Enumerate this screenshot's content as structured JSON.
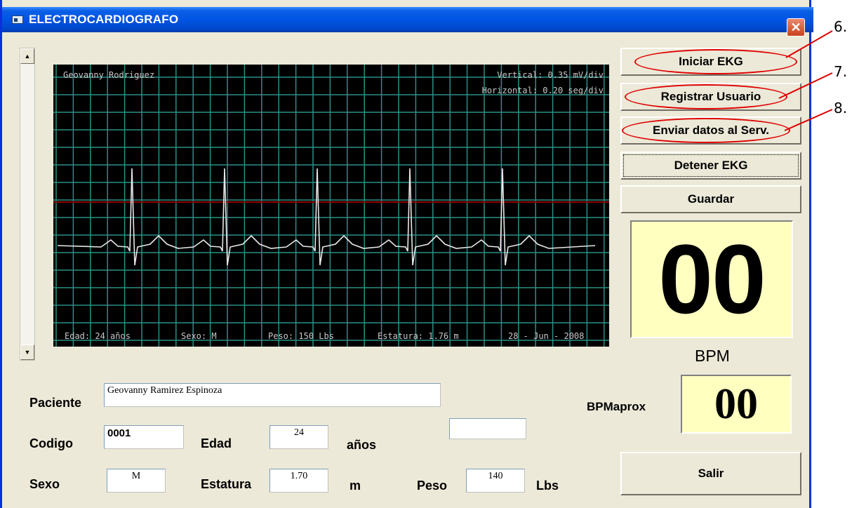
{
  "window": {
    "title": "ELECTROCARDIOGRAFO",
    "close_glyph": "✕"
  },
  "monitor": {
    "top_left": "Geovanny Rodriguez",
    "top_right_1": "Vertical: 0.35 mV/div",
    "top_right_2": "Horizontal: 0.20 seg/div",
    "bottom": [
      "Edad: 24 años",
      "Sexo: M",
      "Peso: 150 Lbs",
      "Estatura: 1.76 m",
      "28 - Jun - 2008"
    ]
  },
  "buttons": {
    "iniciar": "Iniciar EKG",
    "registrar": "Registrar Usuario",
    "enviar": "Enviar datos al Serv.",
    "detener": "Detener EKG",
    "guardar": "Guardar",
    "salir": "Salir"
  },
  "bpm": {
    "value": "00",
    "label": "BPM"
  },
  "bpmaprox": {
    "label": "BPMaprox",
    "value": "00"
  },
  "form": {
    "paciente_label": "Paciente",
    "paciente_value": "Geovanny Ramirez Espinoza",
    "codigo_label": "Codigo",
    "codigo_value": "0001",
    "edad_label": "Edad",
    "edad_value": "24",
    "edad_unit": "años",
    "extra_value": "",
    "sexo_label": "Sexo",
    "sexo_value": "M",
    "estatura_label": "Estatura",
    "estatura_value": "1.70",
    "estatura_unit": "m",
    "peso_label": "Peso",
    "peso_value": "140",
    "peso_unit": "Lbs"
  },
  "callouts": [
    "6.",
    "7.",
    "8."
  ],
  "colors": {
    "titlebar": "#0054e3",
    "grid": "#2a8f86",
    "trace": "#e8e8e8",
    "ref_line": "#8b0000",
    "annotation": "#e00000",
    "bpm_bg": "#ffffc0"
  },
  "icons": {
    "scroll_up": "▲",
    "scroll_down": "▼"
  }
}
